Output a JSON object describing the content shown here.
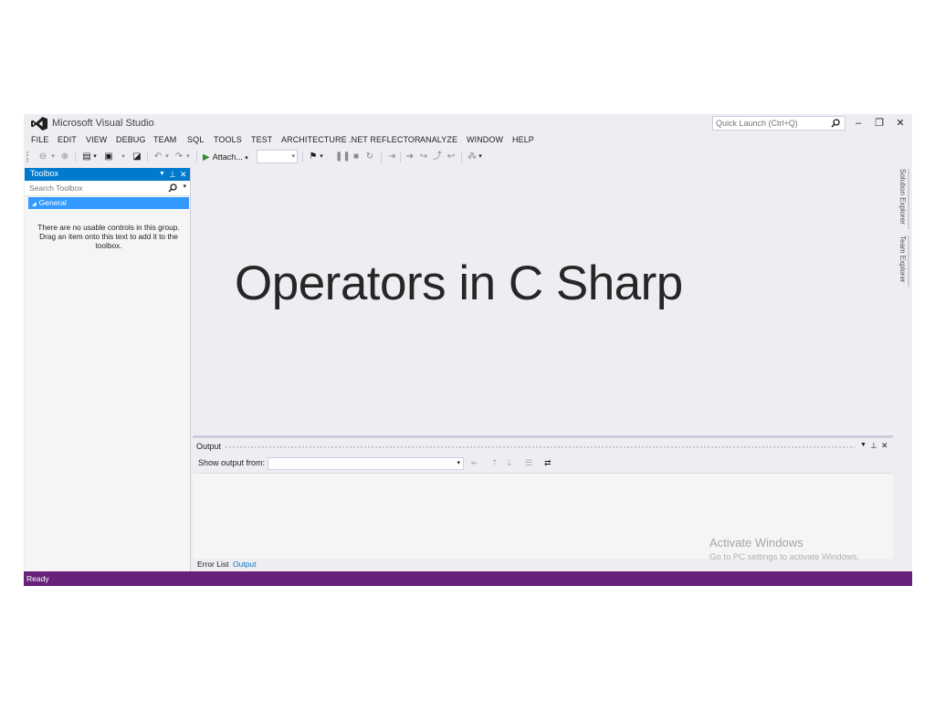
{
  "window": {
    "app_title": "Microsoft Visual Studio",
    "quick_launch_placeholder": "Quick Launch (Ctrl+Q)",
    "controls": {
      "minimize": "–",
      "restore": "❐",
      "close": "✕"
    }
  },
  "menu": {
    "items": [
      "FILE",
      "EDIT",
      "VIEW",
      "DEBUG",
      "TEAM",
      "SQL",
      "TOOLS",
      "TEST",
      "ARCHITECTURE",
      ".NET REFLECTOR",
      "ANALYZE",
      "WINDOW",
      "HELP"
    ]
  },
  "toolbar": {
    "attach_label": "Attach...",
    "play_glyph": "▶",
    "dropdown_glyph": "▾"
  },
  "toolbox": {
    "title": "Toolbox",
    "search_placeholder": "Search Toolbox",
    "group_label": "General",
    "empty_message": "There are no usable controls in this group. Drag an item onto this text to add it to the toolbox."
  },
  "editor": {
    "overlay_title": "Operators in C Sharp"
  },
  "side_tabs": [
    "Solution Explorer",
    "Team Explorer"
  ],
  "output": {
    "title": "Output",
    "show_from_label": "Show output from:",
    "selected_source": "",
    "tabs": [
      "Error List",
      "Output"
    ],
    "active_tab": "Output"
  },
  "watermark": {
    "line1": "Activate Windows",
    "line2": "Go to PC settings to activate Windows."
  },
  "status": {
    "text": "Ready",
    "bar_color": "#68217a"
  },
  "colors": {
    "accent": "#007acc",
    "group_highlight": "#3399ff",
    "background": "#eeeef2"
  }
}
